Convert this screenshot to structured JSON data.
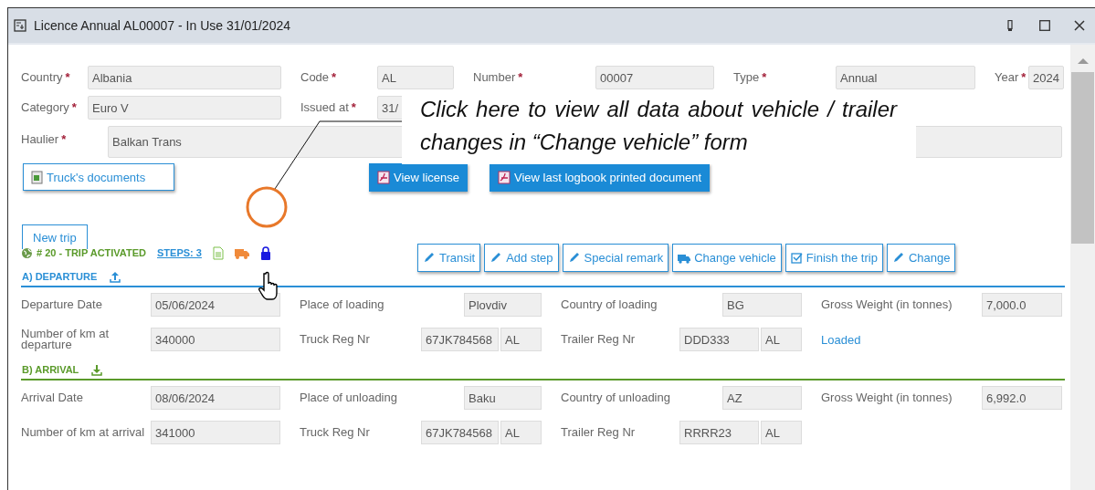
{
  "window": {
    "title": "Licence Annual AL00007 - In Use 31/01/2024"
  },
  "header": {
    "rows": [
      [
        {
          "label": "Country",
          "required_mark": "*",
          "value": "Albania"
        },
        {
          "label": "Code",
          "required_mark": "*",
          "value": "AL"
        },
        {
          "label": "Number",
          "required_mark": "*",
          "value": "00007"
        },
        {
          "label": "Type",
          "required_mark": "*",
          "value": "Annual"
        },
        {
          "label": "Year",
          "required_mark": "*",
          "value": "2024"
        }
      ],
      [
        {
          "label": "Category",
          "required_mark": "*",
          "value": "Euro V"
        },
        {
          "label": "Issued at",
          "required_mark": "*",
          "value": "31/"
        }
      ],
      [
        {
          "label": "Haulier",
          "required_mark": "*",
          "value": "Balkan Trans"
        }
      ]
    ]
  },
  "document_buttons": [
    {
      "label": "Truck's documents",
      "kind": "outline"
    },
    {
      "label": "View license",
      "kind": "primary"
    },
    {
      "label": "View last logbook printed document",
      "kind": "primary"
    }
  ],
  "callout": {
    "text": "Click here to view all data about vehicle / trailer changes in “Change vehicle” form"
  },
  "tabs": [
    {
      "label": "New trip",
      "selected": true
    }
  ],
  "trip": {
    "status": "# 20 - TRIP ACTIVATED",
    "steps_link": "STEPS: 3"
  },
  "actions": [
    {
      "label": "Transit",
      "kind": "edit"
    },
    {
      "label": "Add step",
      "kind": "edit"
    },
    {
      "label": "Special remark",
      "kind": "edit"
    },
    {
      "label": "Change vehicle",
      "kind": "vehicle"
    },
    {
      "label": "Finish the trip",
      "kind": "finish"
    },
    {
      "label": "Change",
      "kind": "edit"
    }
  ],
  "sections": [
    {
      "title": "A) DEPARTURE",
      "color": "#2a8fd6",
      "rows": [
        [
          {
            "label": "Departure Date",
            "values": [
              "05/06/2024"
            ]
          },
          {
            "label": "Place of loading",
            "values": [
              "Plovdiv"
            ]
          },
          {
            "label": "Country of loading",
            "values": [
              "BG"
            ]
          },
          {
            "label": "Gross Weight (in tonnes)",
            "values": [
              "7,000.0"
            ]
          }
        ],
        [
          {
            "label": "Number of km at departure",
            "values": [
              "340000"
            ]
          },
          {
            "label": "Truck Reg Nr",
            "values": [
              "67JK784568",
              "AL"
            ]
          },
          {
            "label": "Trailer Reg Nr",
            "values": [
              "DDD333",
              "AL"
            ]
          },
          {
            "kind": "status",
            "label": "Loaded"
          }
        ]
      ]
    },
    {
      "title": "B) ARRIVAL",
      "color": "#5a9a2a",
      "rows": [
        [
          {
            "label": "Arrival Date",
            "values": [
              "08/06/2024"
            ]
          },
          {
            "label": "Place of unloading",
            "values": [
              "Baku"
            ]
          },
          {
            "label": "Country of unloading",
            "values": [
              "AZ"
            ]
          },
          {
            "label": "Gross Weight (in tonnes)",
            "values": [
              "6,992.0"
            ]
          }
        ],
        [
          {
            "label": "Number of km at arrival",
            "values": [
              "341000"
            ]
          },
          {
            "label": "Truck Reg Nr",
            "values": [
              "67JK784568",
              "AL"
            ]
          },
          {
            "label": "Trailer Reg Nr",
            "values": [
              "RRRR23",
              "AL"
            ]
          }
        ]
      ]
    }
  ]
}
